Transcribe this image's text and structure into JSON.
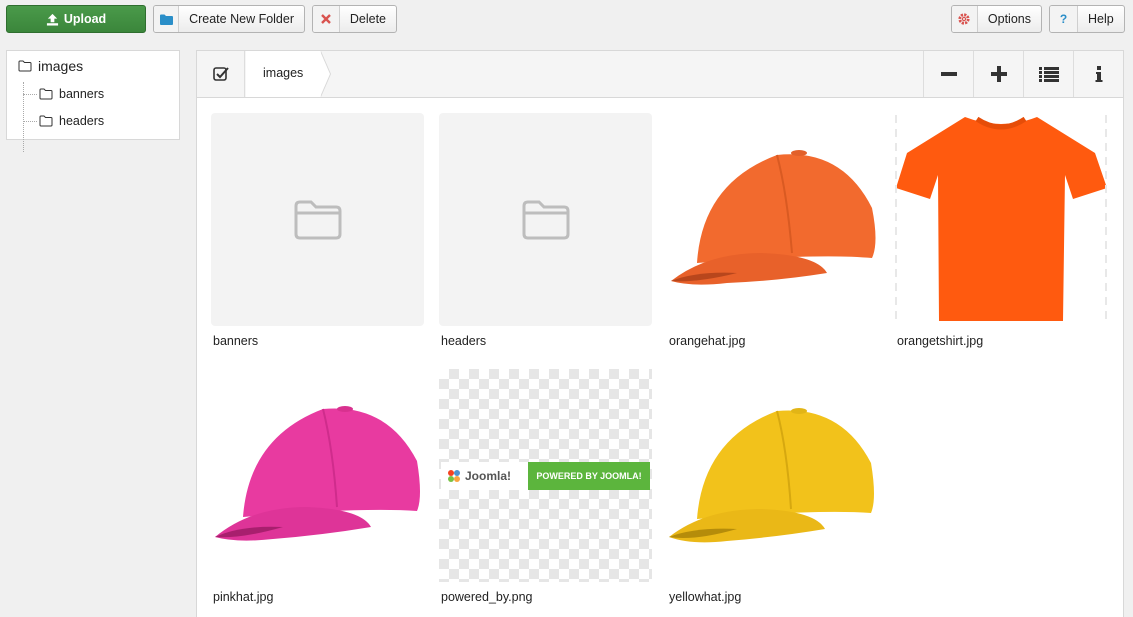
{
  "toolbar": {
    "upload": "Upload",
    "create_folder": "Create New Folder",
    "delete": "Delete",
    "options": "Options",
    "help": "Help"
  },
  "tree": {
    "root": "images",
    "children": [
      "banners",
      "headers"
    ]
  },
  "breadcrumb": "images",
  "panel_tools": [
    "zoom-out-icon",
    "zoom-in-icon",
    "list-view-icon",
    "info-icon"
  ],
  "items": [
    {
      "name": "banners",
      "type": "folder"
    },
    {
      "name": "headers",
      "type": "folder"
    },
    {
      "name": "orangehat.jpg",
      "type": "image",
      "color": "#f26a2e"
    },
    {
      "name": "orangetshirt.jpg",
      "type": "image",
      "color": "#ff5a0f"
    },
    {
      "name": "pinkhat.jpg",
      "type": "image",
      "color": "#e83aa0"
    },
    {
      "name": "powered_by.png",
      "type": "image",
      "banner_left": "Joomla!",
      "banner_right": "POWERED BY JOOMLA!"
    },
    {
      "name": "yellowhat.jpg",
      "type": "image",
      "color": "#f2c21b"
    }
  ],
  "colors": {
    "upload_green": "#3f8f3f",
    "folder_icon_blue": "#2a8ec8",
    "delete_red": "#d9534f",
    "options_red": "#d9534f",
    "help_blue": "#2a8ec8"
  }
}
